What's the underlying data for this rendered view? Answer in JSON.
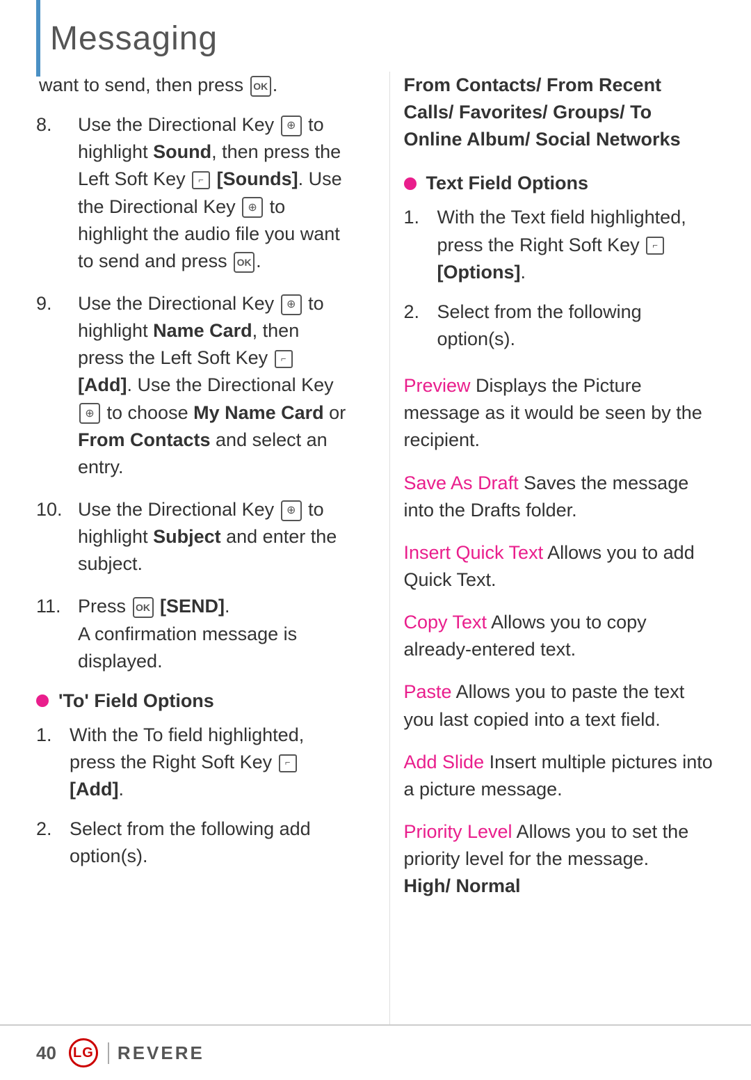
{
  "page": {
    "title": "Messaging",
    "footer": {
      "page_number": "40",
      "logo_text": "LG",
      "brand_text": "REVERE"
    }
  },
  "left_col": {
    "intro": {
      "text_before": "want to send, then press",
      "icon": "OK"
    },
    "numbered_items": [
      {
        "number": "8.",
        "content": "Use the Directional Key",
        "icon_type": "dir",
        "rest": " to highlight Sound, then press the Left Soft Key",
        "icon2_type": "softkey",
        "bold_part": "[Sounds]",
        "continuation": ". Use the Directional Key",
        "icon3_type": "dir",
        "continuation2": " to highlight the audio file you want to send and press",
        "icon4_type": "ok"
      },
      {
        "number": "9.",
        "content": "Use the Directional Key",
        "icon_type": "dir",
        "rest": " to highlight Name Card, then press the Left Soft Key",
        "icon2_type": "softkey",
        "bold_part1": "[Add]",
        "continuation": ". Use the Directional Key",
        "icon3_type": "dir",
        "continuation2": " to choose ",
        "bold_part2": "My Name Card",
        "continuation3": " or ",
        "bold_part3": "From Contacts",
        "continuation4": " and select an entry."
      },
      {
        "number": "10.",
        "content": "Use the Directional Key",
        "icon_type": "dir",
        "rest": " to highlight ",
        "bold_part": "Subject",
        "continuation": " and enter the subject."
      },
      {
        "number": "11.",
        "content": "Press",
        "icon_type": "ok",
        "bold_part": "[SEND]",
        "continuation": "A confirmation message is displayed."
      }
    ],
    "bullet_to_field": {
      "label": "'To' Field Options",
      "items": [
        {
          "num": "1.",
          "text_before": "With the To field highlighted, press the Right Soft Key",
          "icon_type": "softkey",
          "bold": "[Add]",
          "text_after": ""
        },
        {
          "num": "2.",
          "text": "Select from the following add option(s)."
        }
      ]
    }
  },
  "right_col": {
    "header_block": "From Contacts/ From Recent Calls/ Favorites/ Groups/ To Online Album/ Social Networks",
    "bullet_text_field": {
      "label": "Text Field Options",
      "items": [
        {
          "num": "1.",
          "text_before": "With the Text field highlighted, press the Right Soft Key",
          "icon_type": "softkey",
          "bold": "[Options]",
          "text_after": ""
        },
        {
          "num": "2.",
          "text": "Select from the following option(s)."
        }
      ]
    },
    "options": [
      {
        "label": "Preview",
        "description": "  Displays the Picture message as it would be seen by the recipient."
      },
      {
        "label": "Save As Draft",
        "description": "  Saves the message into the Drafts folder."
      },
      {
        "label": "Insert Quick Text",
        "description": "  Allows you to add Quick Text."
      },
      {
        "label": "Copy Text",
        "description": "  Allows you to copy already-entered text."
      },
      {
        "label": "Paste",
        "description": "  Allows you to paste the text you last copied into a text field."
      },
      {
        "label": "Add Slide",
        "description": "  Insert multiple pictures into a picture message."
      },
      {
        "label": "Priority Level",
        "description": "  Allows you to set the priority level for the message.",
        "bold_end": "High/ Normal"
      }
    ]
  }
}
